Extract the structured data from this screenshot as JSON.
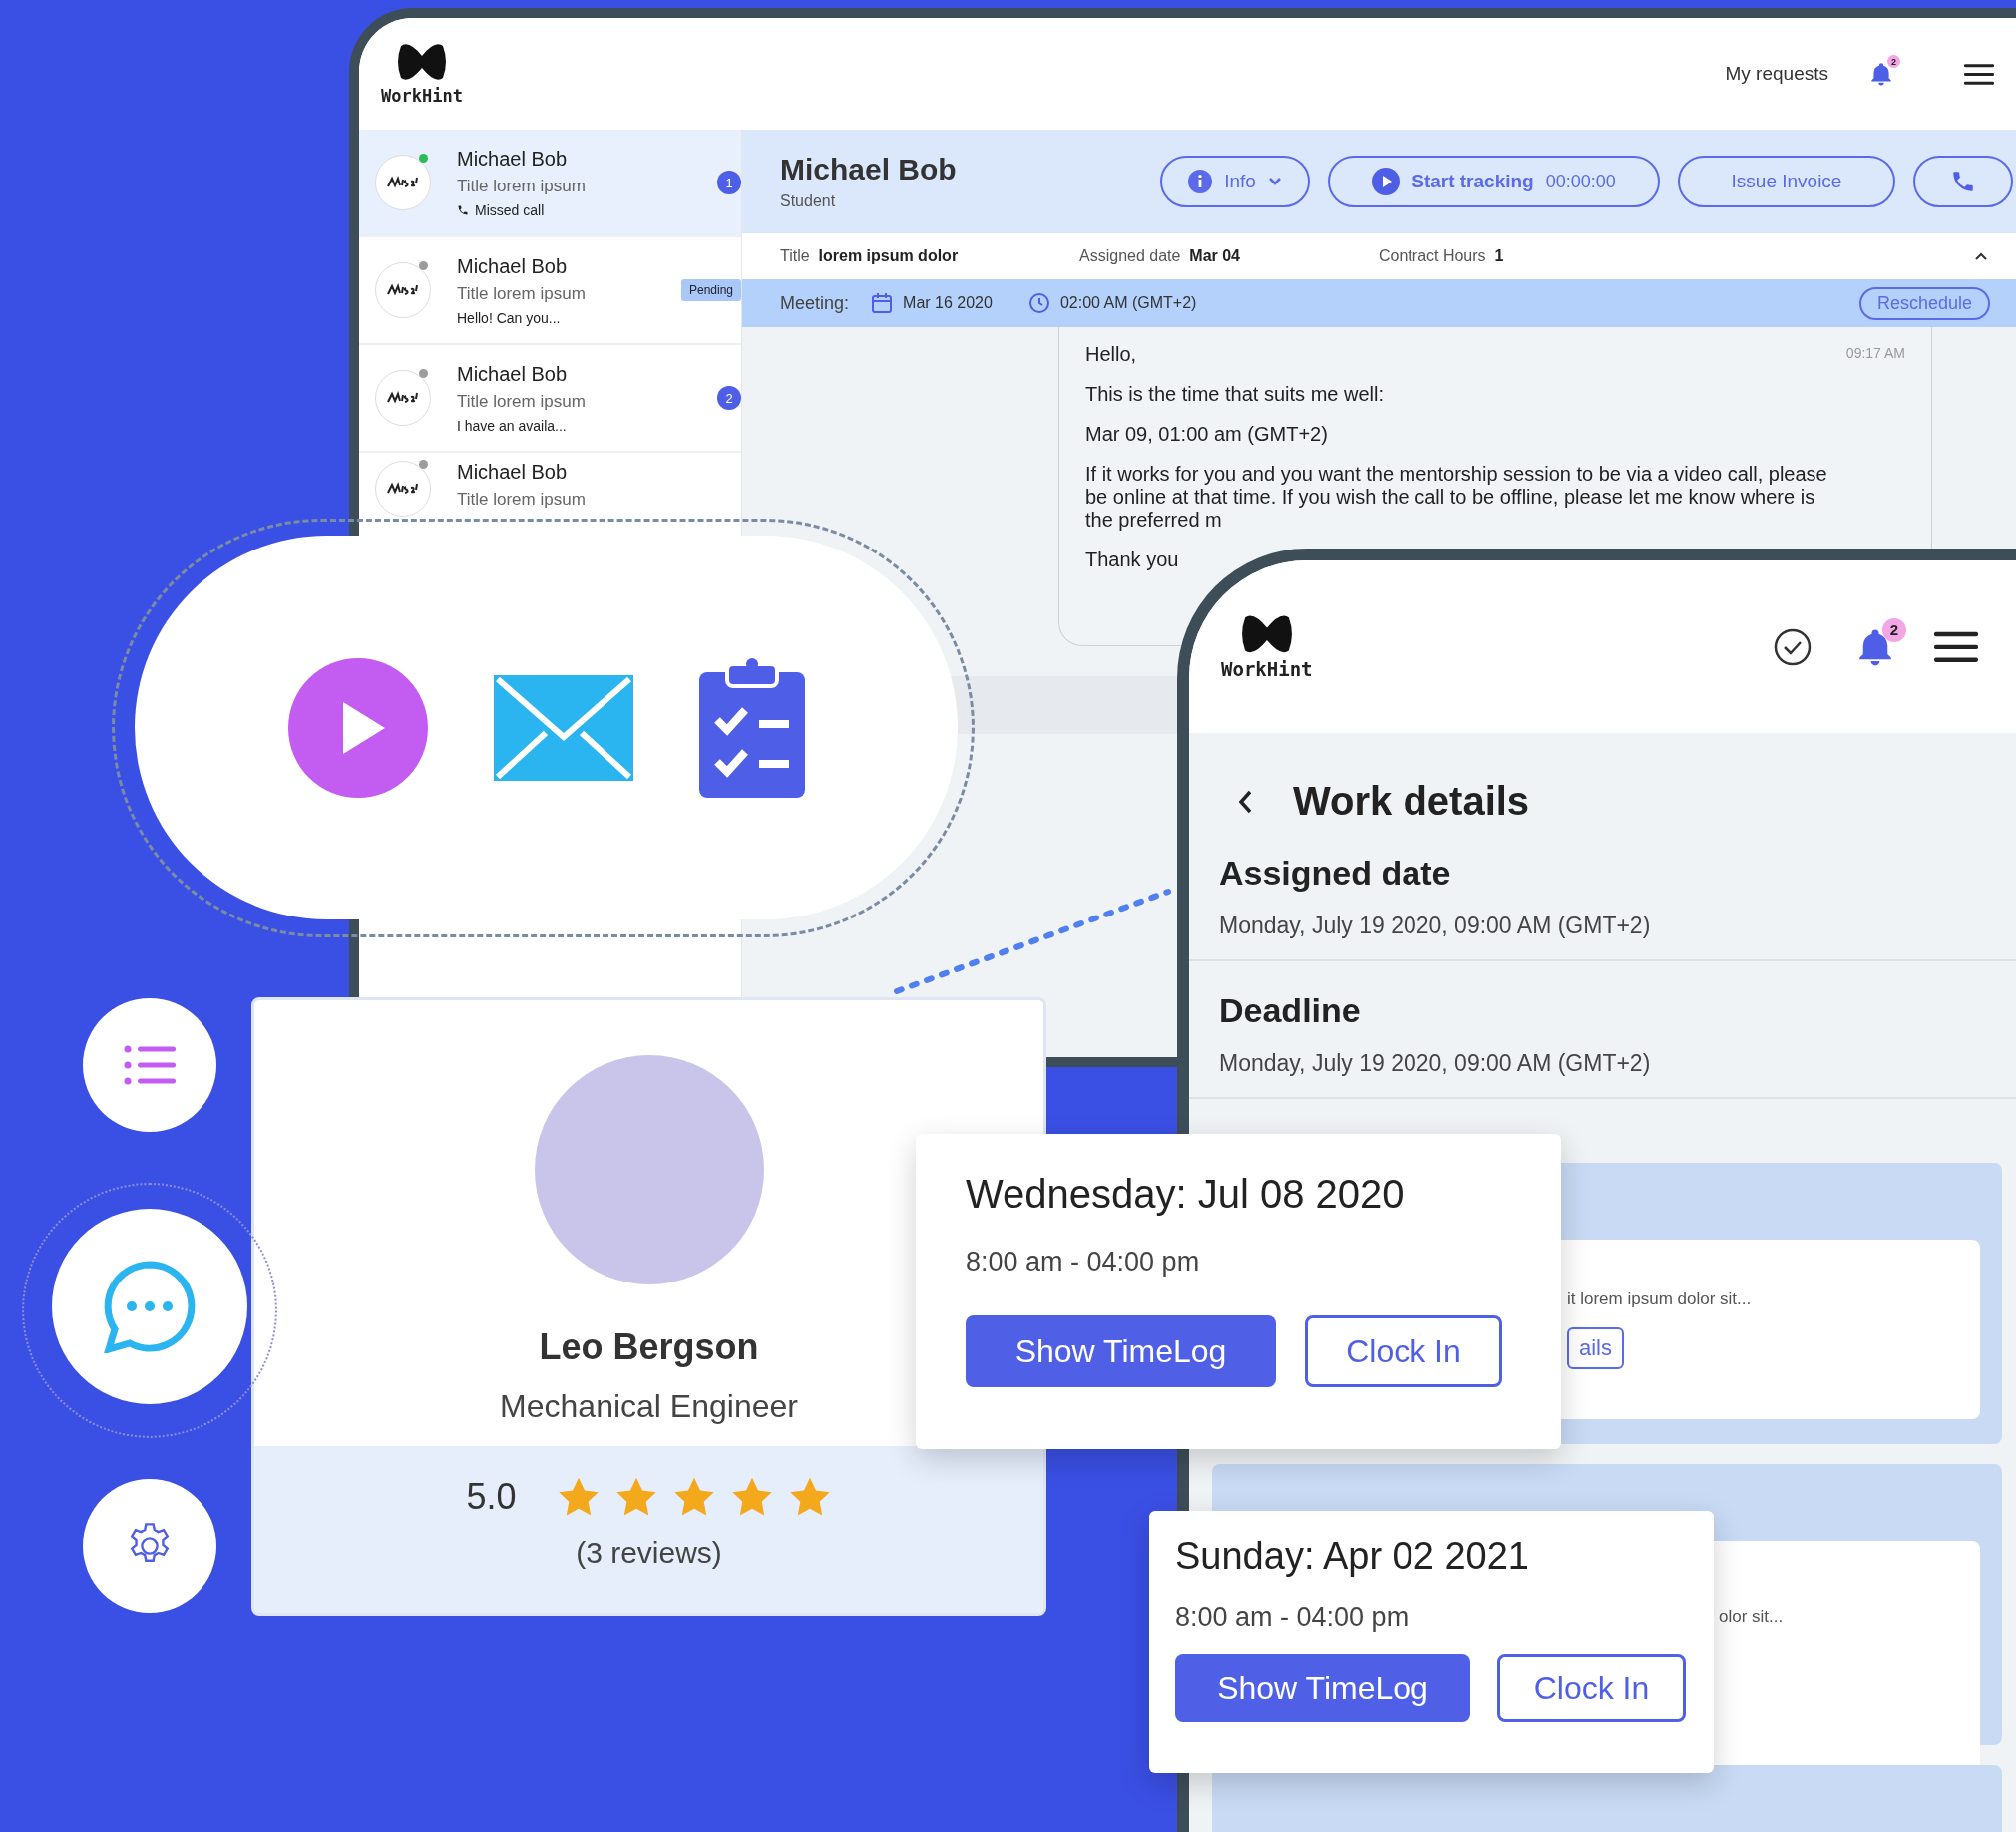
{
  "desktop": {
    "logo": "WorkHint",
    "nav_link": "My requests",
    "notification_count": "2",
    "conversations": [
      {
        "name": "Michael Bob",
        "subtitle": "Title lorem ipsum",
        "preview": "Missed call",
        "kind": "call",
        "online": true,
        "badge": "1",
        "selected": true
      },
      {
        "name": "Michael Bob",
        "subtitle": "Title lorem ipsum",
        "preview": "Hello! Can you...",
        "kind": "message",
        "online": false,
        "tag": "Pending",
        "selected": false
      },
      {
        "name": "Michael Bob",
        "subtitle": "Title lorem ipsum",
        "preview": "I have an availa...",
        "kind": "message",
        "online": false,
        "badge": "2",
        "selected": false
      },
      {
        "name": "Michael Bob",
        "subtitle": "Title lorem ipsum",
        "online": false,
        "selected": false
      }
    ],
    "chat": {
      "name": "Michael Bob",
      "role": "Student",
      "info_button": "Info",
      "tracking_button": "Start tracking",
      "timer": "00:00:00",
      "invoice_button": "Issue Invoice",
      "details": [
        {
          "label": "Title",
          "value": "lorem ipsum dolor"
        },
        {
          "label": "Assigned date",
          "value": "Mar 04"
        },
        {
          "label": "Contract Hours",
          "value": "1"
        }
      ],
      "meeting": {
        "label": "Meeting:",
        "date": "Mar 16 2020",
        "time": "02:00 AM (GMT+2)",
        "button": "Reschedule"
      },
      "message": {
        "time": "09:17 AM",
        "paragraphs": [
          "Hello,",
          "This is the time that suits me well:",
          "Mar 09, 01:00 am (GMT+2)",
          "If it works for you and you want the mentorship session to be via a video call, please be online at that time. If you wish the call to be offline, please let me know where is the preferred m",
          "Thank you"
        ]
      }
    }
  },
  "profile": {
    "name": "Leo Bergson",
    "title": "Mechanical Engineer",
    "rating": "5.0",
    "stars": 5,
    "reviews": "(3 reviews)"
  },
  "mobile": {
    "logo": "WorkHint",
    "notification_count": "2",
    "title": "Work details",
    "fields": [
      {
        "label": "Assigned date",
        "value": "Monday, July 19 2020, 09:00 AM (GMT+2)"
      },
      {
        "label": "Deadline",
        "value": "Monday, July 19 2020, 09:00 AM (GMT+2)"
      }
    ],
    "cards": [
      {
        "text": "it lorem ipsum dolor sit...",
        "button": "ails"
      },
      {
        "text": "olor sit..."
      }
    ]
  },
  "schedules": [
    {
      "date": "Wednesday: Jul 08 2020",
      "hours": "8:00 am - 04:00 pm",
      "primary_button": "Show TimeLog",
      "secondary_button": "Clock In"
    },
    {
      "date": "Sunday: Apr 02 2021",
      "hours": "8:00 am - 04:00 pm",
      "primary_button": "Show TimeLog",
      "secondary_button": "Clock In"
    }
  ]
}
